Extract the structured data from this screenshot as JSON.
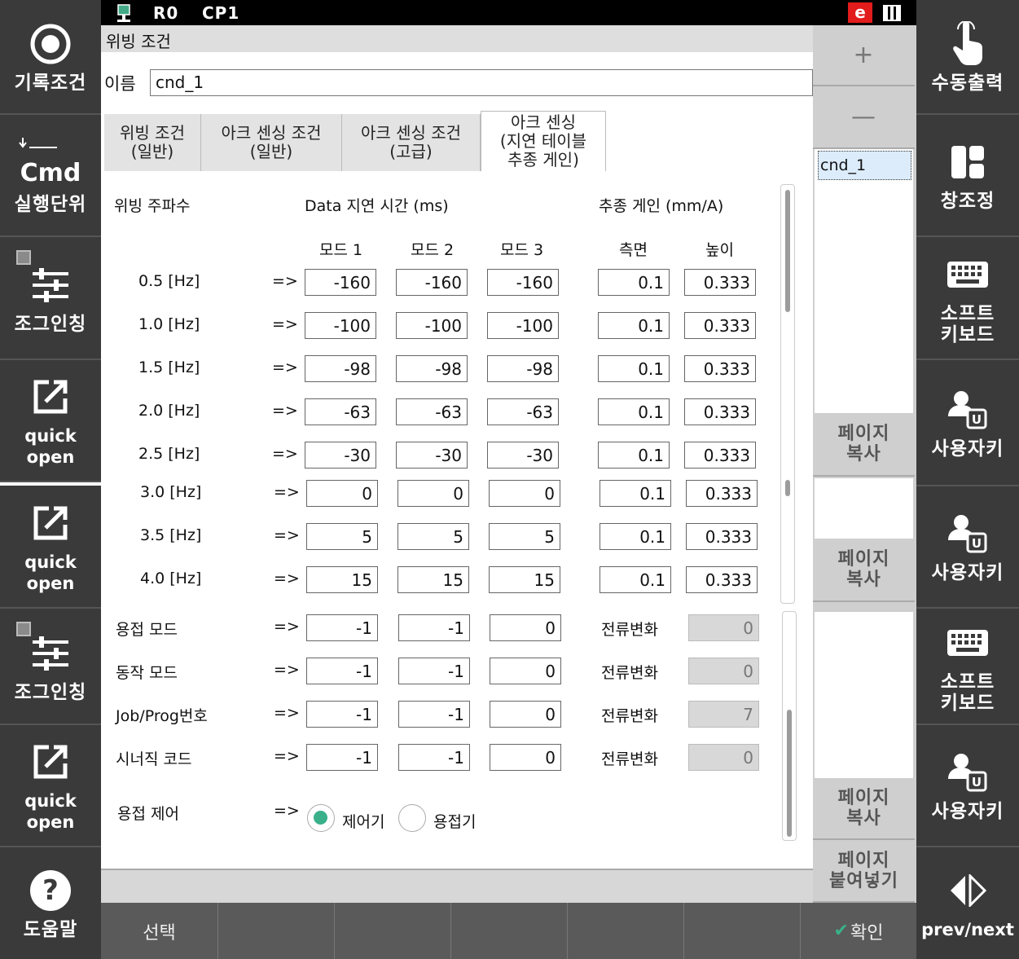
{
  "topbar": {
    "robot": "R0",
    "program": "CP1",
    "badge": "e"
  },
  "left_buttons": [
    {
      "label": "기록조건",
      "icon": "record-icon"
    },
    {
      "label": "실행단위",
      "cmd": "Cmd",
      "icon": "cmd-icon"
    },
    {
      "label": "조그인칭",
      "icon": "jog-sliders-icon"
    },
    {
      "label": "quick open",
      "icon": "quick-open-icon"
    },
    {
      "label": "quick open",
      "icon": "quick-open-icon"
    },
    {
      "label": "조그인칭",
      "icon": "jog-sliders-icon"
    },
    {
      "label": "quick open",
      "icon": "quick-open-icon"
    },
    {
      "label": "도움말",
      "icon": "help-icon"
    }
  ],
  "right_buttons": [
    {
      "label": "수동출력",
      "icon": "hand-pointer-icon"
    },
    {
      "label": "창조정",
      "icon": "window-layout-icon"
    },
    {
      "label": "소프트\n키보드",
      "icon": "keyboard-icon"
    },
    {
      "label": "사용자키",
      "icon": "user-key-icon"
    },
    {
      "label": "사용자키",
      "icon": "user-key-icon"
    },
    {
      "label": "소프트\n키보드",
      "icon": "keyboard-icon"
    },
    {
      "label": "사용자키",
      "icon": "user-key-icon"
    },
    {
      "label": "prev/next",
      "icon": "prev-next-icon"
    }
  ],
  "dialog": {
    "title": "위빙 조건",
    "name_label": "이름",
    "name_value": "cnd_1",
    "tabs": [
      {
        "line1": "위빙 조건",
        "line2": "(일반)"
      },
      {
        "line1": "아크 센싱 조건",
        "line2": "(일반)"
      },
      {
        "line1": "아크 센싱 조건",
        "line2": "(고급)"
      },
      {
        "line1": "아크 센싱",
        "line2": "(지연 테이블",
        "line3": "추종 게인)"
      }
    ],
    "headers": {
      "freq": "위빙 주파수",
      "delay": "Data 지연 시간 (ms)",
      "gain": "추종 게인 (mm/A)",
      "mode1": "모드 1",
      "mode2": "모드 2",
      "mode3": "모드 3",
      "side": "측면",
      "height": "높이"
    },
    "arrow": "=>",
    "rows": [
      {
        "freq": "0.5 [Hz]",
        "m1": "-160",
        "m2": "-160",
        "m3": "-160",
        "side": "0.1",
        "height": "0.333"
      },
      {
        "freq": "1.0 [Hz]",
        "m1": "-100",
        "m2": "-100",
        "m3": "-100",
        "side": "0.1",
        "height": "0.333"
      },
      {
        "freq": "1.5 [Hz]",
        "m1": "-98",
        "m2": "-98",
        "m3": "-98",
        "side": "0.1",
        "height": "0.333"
      },
      {
        "freq": "2.0 [Hz]",
        "m1": "-63",
        "m2": "-63",
        "m3": "-63",
        "side": "0.1",
        "height": "0.333"
      },
      {
        "freq": "2.5 [Hz]",
        "m1": "-30",
        "m2": "-30",
        "m3": "-30",
        "side": "0.1",
        "height": "0.333"
      },
      {
        "freq": "3.0 [Hz]",
        "m1": "0",
        "m2": "0",
        "m3": "0",
        "side": "0.1",
        "height": "0.333"
      },
      {
        "freq": "3.5 [Hz]",
        "m1": "5",
        "m2": "5",
        "m3": "5",
        "side": "0.1",
        "height": "0.333"
      },
      {
        "freq": "4.0 [Hz]",
        "m1": "15",
        "m2": "15",
        "m3": "15",
        "side": "0.1",
        "height": "0.333"
      }
    ],
    "lower_rows": [
      {
        "label": "용접 모드",
        "m1": "-1",
        "m2": "-1",
        "m3": "0",
        "cur_label": "전류변화",
        "cur": "0"
      },
      {
        "label": "동작 모드",
        "m1": "-1",
        "m2": "-1",
        "m3": "0",
        "cur_label": "전류변화",
        "cur": "0"
      },
      {
        "label": "Job/Prog번호",
        "m1": "-1",
        "m2": "-1",
        "m3": "0",
        "cur_label": "전류변화",
        "cur": "7"
      },
      {
        "label": "시너직 코드",
        "m1": "-1",
        "m2": "-1",
        "m3": "0",
        "cur_label": "전류변화",
        "cur": "0"
      }
    ],
    "weld_control": {
      "label": "용접 제어",
      "opt1": "제어기",
      "opt2": "용접기",
      "selected": "opt1"
    }
  },
  "list_panel": {
    "add": "+",
    "remove": "—",
    "items": [
      "cnd_1"
    ],
    "page_copy": "페이지\n복사",
    "page_paste": "페이지\n붙여넣기"
  },
  "bottombar": {
    "select": "선택",
    "confirm": "확인"
  },
  "colors": {
    "accent": "#3ab08a",
    "badge": "#e21b1b",
    "selected_item": "#dcecfb"
  }
}
